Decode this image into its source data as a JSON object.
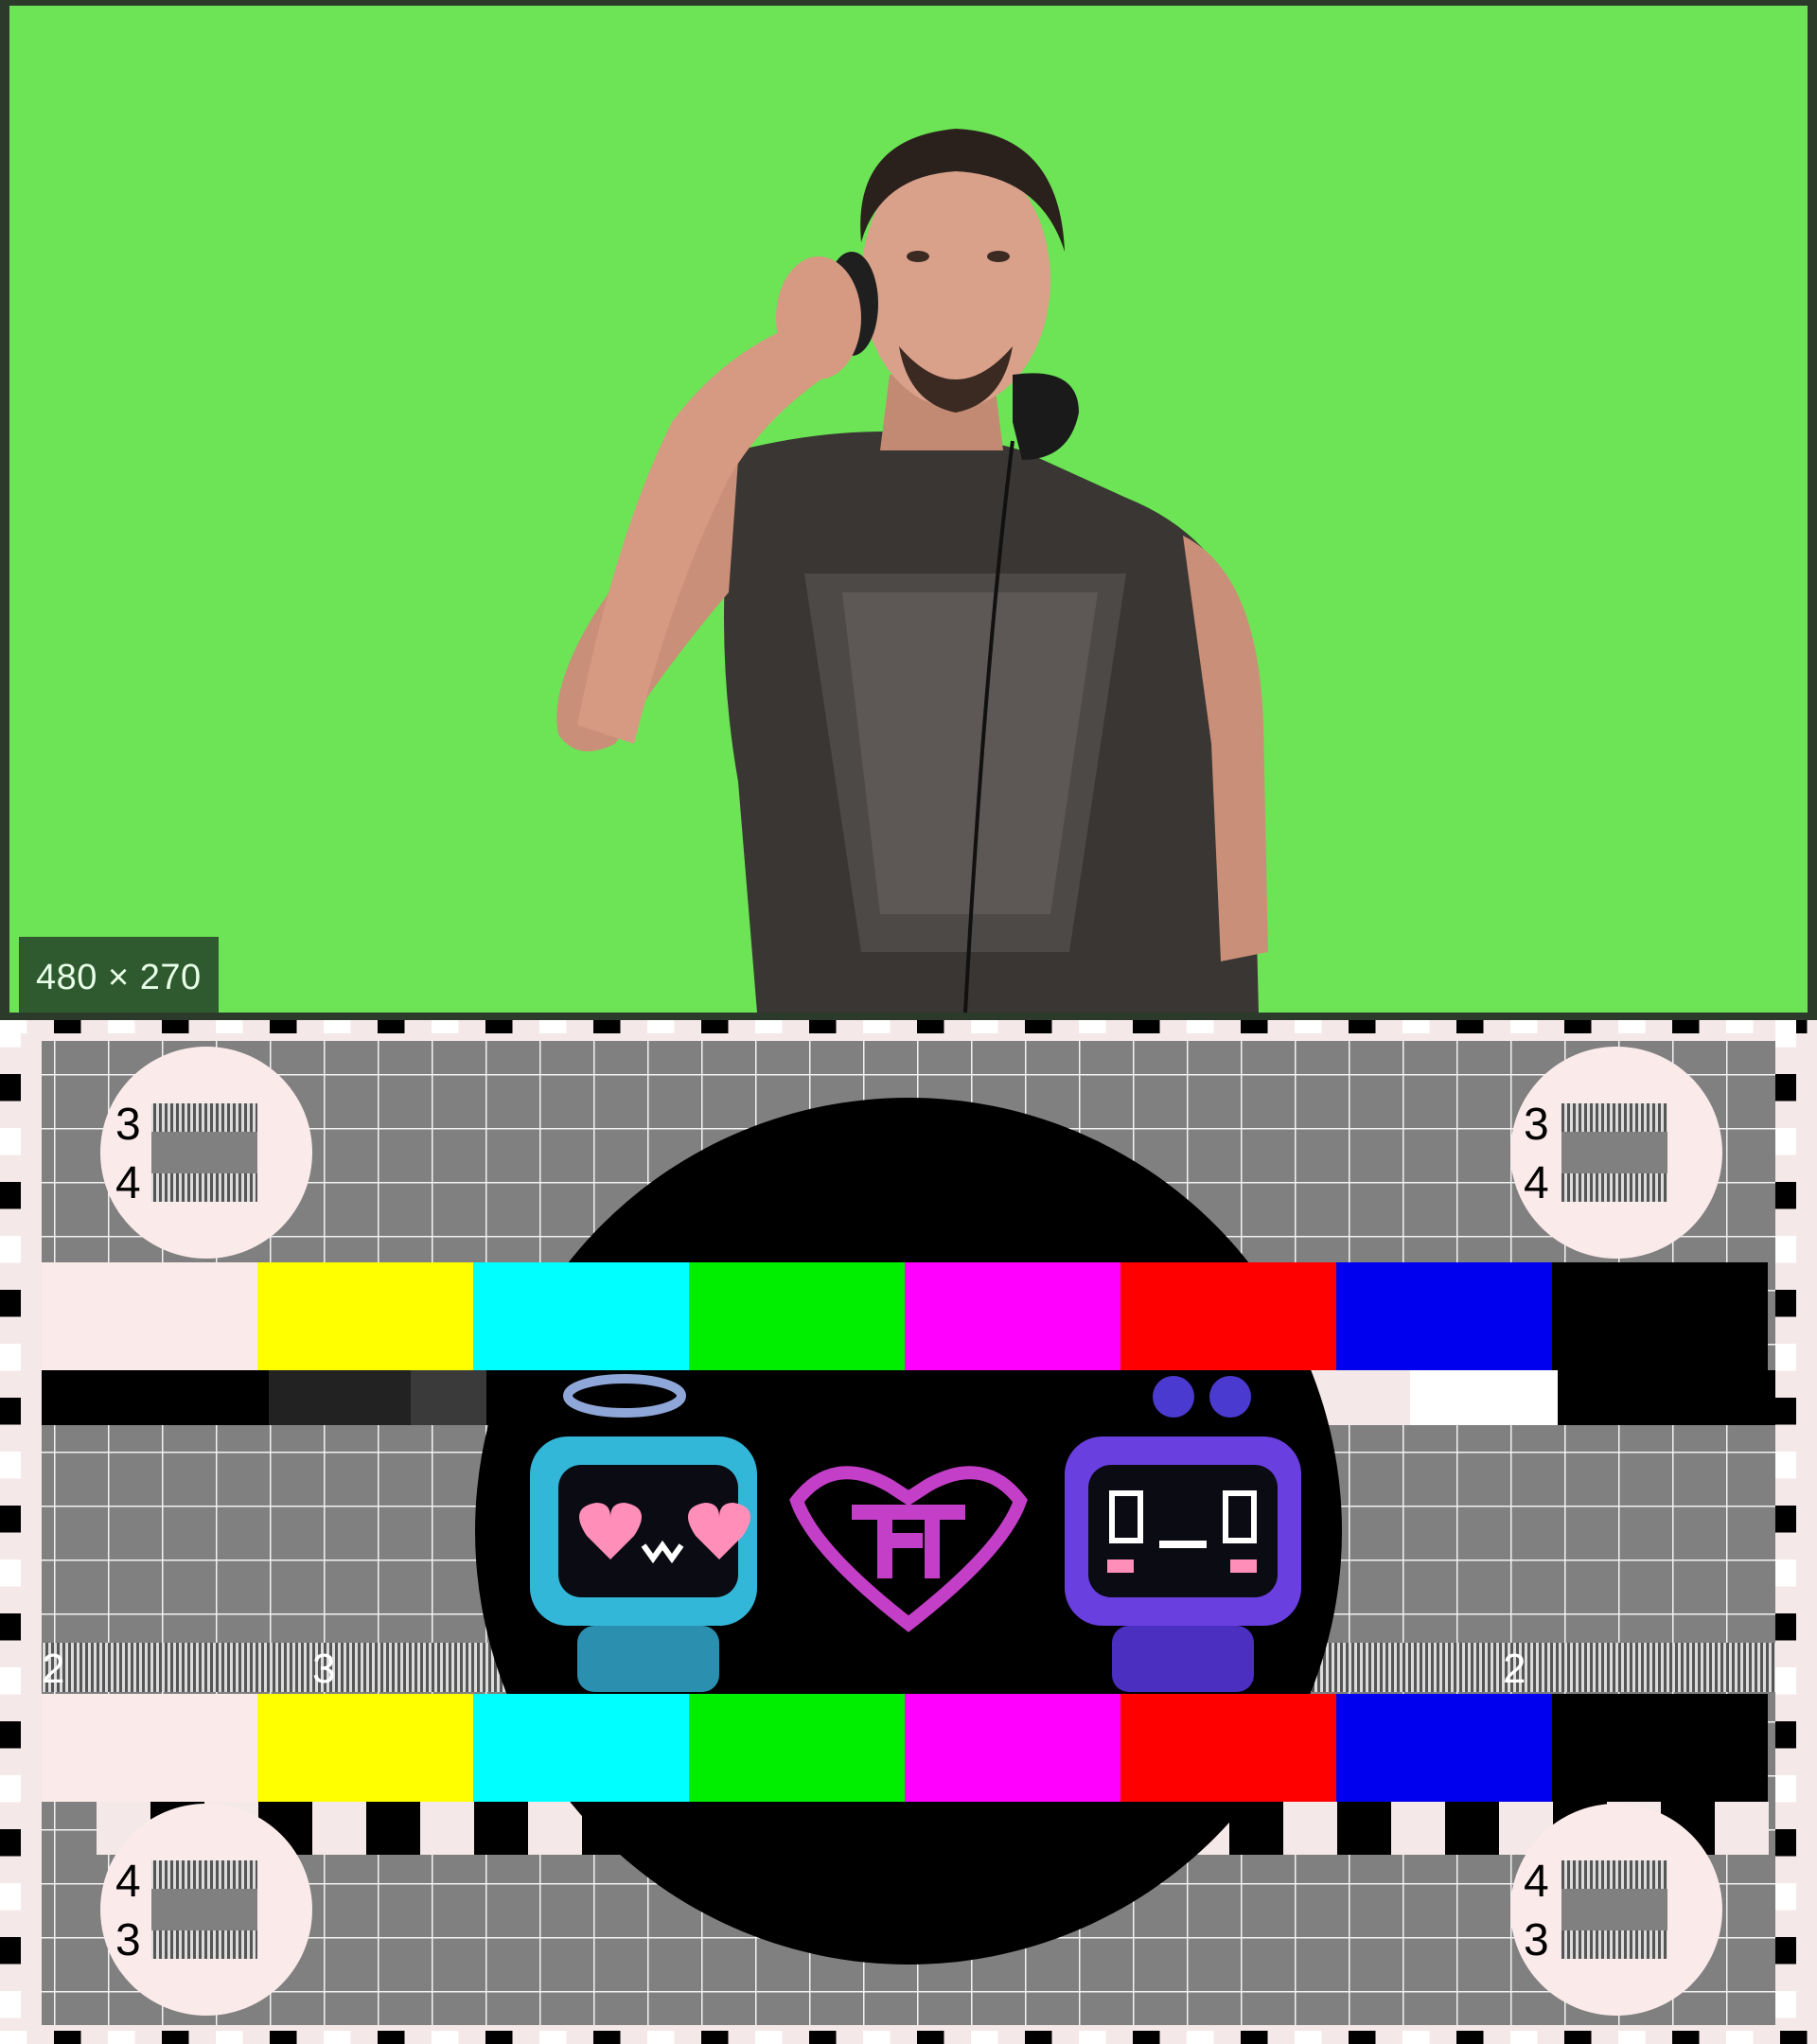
{
  "top_image": {
    "dimensions_label": "480 × 270",
    "background_color": "#6ce455"
  },
  "test_card": {
    "corner_labels": {
      "top_left_a": "3",
      "top_left_b": "4",
      "top_right_a": "3",
      "top_right_b": "4",
      "bottom_left_a": "4",
      "bottom_left_b": "3",
      "bottom_right_a": "4",
      "bottom_right_b": "3"
    },
    "scale_labels": {
      "left_2": "2",
      "left_3": "3",
      "right_2": "2"
    },
    "color_bars": [
      "#fbeaea",
      "#ffff00",
      "#00ffff",
      "#00ee00",
      "#ff00ff",
      "#ff0000",
      "#0000ee",
      "#000000"
    ],
    "logo_color": "#c43fc8",
    "robot_left_color": "#33b7d8",
    "robot_right_color": "#6a3fe0"
  }
}
